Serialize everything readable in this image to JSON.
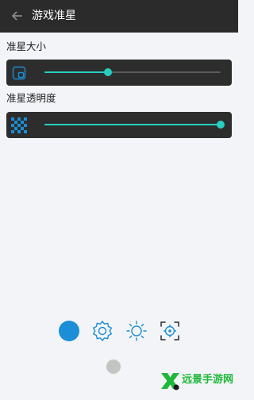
{
  "header": {
    "title": "游戏准星",
    "back_icon": "arrow-left-icon"
  },
  "size_setting": {
    "label": "准星大小",
    "icon": "crosshair-size-icon",
    "value": 0.36
  },
  "opacity_setting": {
    "label": "准星透明度",
    "icon": "checkerboard-icon",
    "value": 1.0
  },
  "bottom_bar": {
    "items": [
      {
        "icon": "filled-circle-icon",
        "color": "#1a8ed6",
        "selected": true
      },
      {
        "icon": "gear-icon",
        "color": "#1a8ed6"
      },
      {
        "icon": "brightness-icon",
        "color": "#1a8ed6"
      },
      {
        "icon": "crosshair-target-icon",
        "color": "#1a8ed6"
      }
    ],
    "toggle": {
      "state": "off"
    }
  },
  "watermark": {
    "text": "远景手游网"
  },
  "colors": {
    "accent": "#27cfc1",
    "header_bg": "#2b2b2b",
    "panel_bg": "#2d2d2d",
    "icon_blue": "#1a8ed6"
  }
}
